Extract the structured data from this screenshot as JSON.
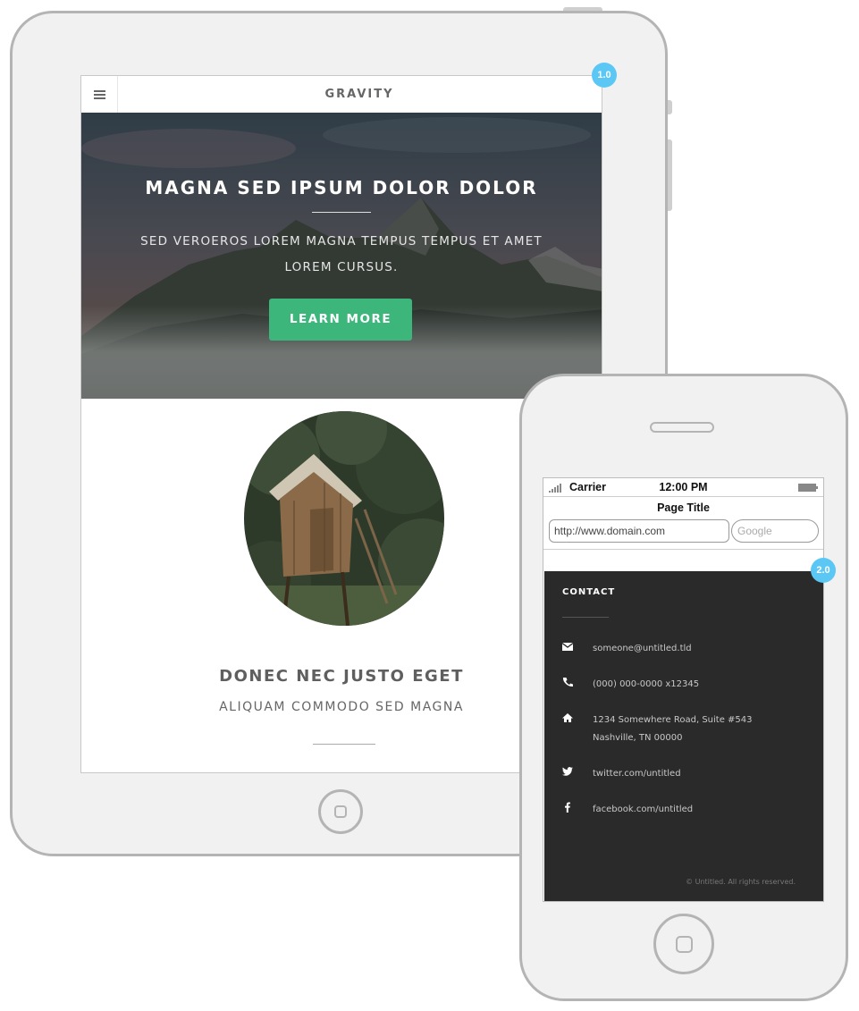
{
  "tablet": {
    "badge": "1.0",
    "nav": {
      "brand": "GRAVITY",
      "menu_icon": "hamburger-icon"
    },
    "hero": {
      "title": "MAGNA SED IPSUM DOLOR DOLOR",
      "subtitle": "SED VEROEROS LOREM MAGNA TEMPUS TEMPUS ET AMET LOREM CURSUS.",
      "button": "LEARN MORE"
    },
    "feature": {
      "title": "DONEC NEC JUSTO EGET",
      "subtitle": "ALIQUAM COMMODO SED MAGNA"
    }
  },
  "phone": {
    "badge": "2.0",
    "status": {
      "carrier": "Carrier",
      "time": "12:00 PM"
    },
    "browser": {
      "page_title": "Page Title",
      "url": "http://www.domain.com",
      "search_placeholder": "Google"
    },
    "contact": {
      "heading": "CONTACT",
      "items": [
        {
          "icon": "envelope-icon",
          "text": "someone@untitled.tld"
        },
        {
          "icon": "phone-icon",
          "text": "(000) 000-0000 x12345"
        },
        {
          "icon": "home-icon",
          "text": "1234 Somewhere Road, Suite #543",
          "text2": "Nashville, TN 00000"
        },
        {
          "icon": "twitter-icon",
          "text": "twitter.com/untitled"
        },
        {
          "icon": "facebook-icon",
          "text": "facebook.com/untitled"
        }
      ],
      "copyright": "© Untitled. All rights reserved."
    }
  },
  "colors": {
    "accent_green": "#3db67b",
    "badge_blue": "#5bc7f5",
    "footer_dark": "#2a2a2a"
  }
}
